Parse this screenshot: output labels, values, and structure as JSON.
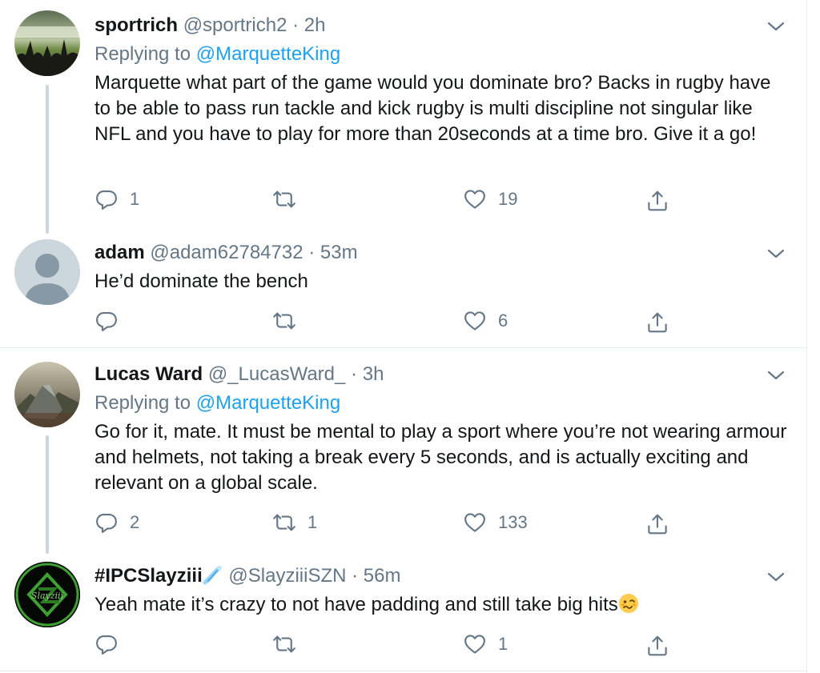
{
  "tweets": [
    {
      "name": "sportrich",
      "handle": "@sportrich2",
      "dot": "·",
      "time": "2h",
      "replying_prefix": "Replying to ",
      "replying_to": "@MarquetteKing",
      "text": "Marquette what part of the game would you dominate bro? Backs in rugby have to be able to pass run tackle and kick rugby is multi discipline not singular like NFL and you have to play for more than 20seconds at a time bro. Give it a go!",
      "replies": "1",
      "retweets": "",
      "likes": "19"
    },
    {
      "name": "adam",
      "handle": "@adam62784732",
      "dot": "·",
      "time": "53m",
      "text": "He’d dominate the bench",
      "replies": "",
      "retweets": "",
      "likes": "6"
    },
    {
      "name": "Lucas Ward",
      "handle": "@_LucasWard_",
      "dot": "·",
      "time": "3h",
      "replying_prefix": "Replying to ",
      "replying_to": "@MarquetteKing",
      "text": "Go for it, mate. It must be mental to play a sport where you’re not wearing armour and helmets, not taking a break every 5 seconds, and is actually exciting and relevant on a global scale.",
      "replies": "2",
      "retweets": "1",
      "likes": "133"
    },
    {
      "name": "#IPCSlayziii",
      "handle": "@SlayziiiSZN",
      "dot": "·",
      "time": "56m",
      "text": "Yeah mate it’s crazy to not have padding and still take big hits",
      "avatar_text": "Slayziii",
      "replies": "",
      "retweets": "",
      "likes": "1"
    }
  ],
  "icons": {
    "reply": "reply-icon",
    "retweet": "retweet-icon",
    "like": "heart-icon",
    "share": "share-icon",
    "more": "chevron-down-icon",
    "emoji": "woozy-face-icon",
    "name_emoji": "comet-icon"
  },
  "colors": {
    "link": "#1da1f2",
    "secondary_text": "#657786",
    "text": "#14171a",
    "thread_line": "#ccd6dd",
    "divider": "#e6ecf0"
  }
}
